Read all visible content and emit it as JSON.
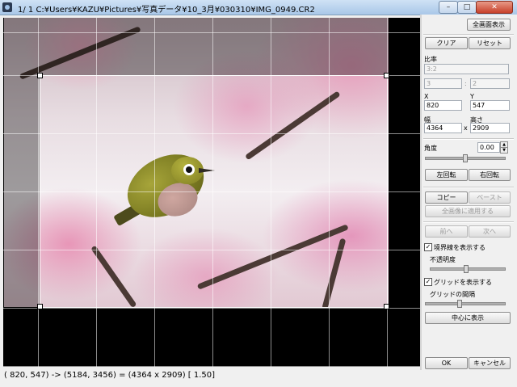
{
  "titlebar": {
    "title": "1/   1  C:¥Users¥KAZU¥Pictures¥写真データ¥10_3月¥030310¥IMG_0949.CR2",
    "minimize_glyph": "–",
    "maximize_glyph": "□",
    "close_glyph": "✕"
  },
  "status_bar": {
    "text": "( 820,  547) -> (5184, 3456) = (4364 x 2909) [ 1.50]"
  },
  "panel": {
    "fullscreen_button": "全画面表示",
    "clear_button": "クリア",
    "reset_button": "リセット",
    "ratio_label": "比率",
    "ratio_value": "3:2",
    "ratio_w": "3",
    "ratio_sep": ":",
    "ratio_h": "2",
    "x_label": "X",
    "y_label": "Y",
    "x_value": "820",
    "y_value": "547",
    "width_label": "幅",
    "height_label": "高さ",
    "width_value": "4364",
    "times": "x",
    "height_value": "2909",
    "angle_label": "角度",
    "angle_value": "0.00",
    "rotate_left_button": "左回転",
    "rotate_right_button": "右回転",
    "copy_button": "コピー",
    "paste_button": "ペースト",
    "apply_all_button": "全画像に適用する",
    "prev_button": "前へ",
    "next_button": "次へ",
    "show_border_label": "境界線を表示する",
    "show_border_checked": true,
    "opacity_label": "不透明度",
    "show_grid_label": "グリッドを表示する",
    "show_grid_checked": true,
    "grid_spacing_label": "グリッドの間隔",
    "center_button": "中心に表示",
    "ok_button": "OK",
    "cancel_button": "キャンセル",
    "check_mark": "✓",
    "spin_up": "▲",
    "spin_down": "▼"
  }
}
